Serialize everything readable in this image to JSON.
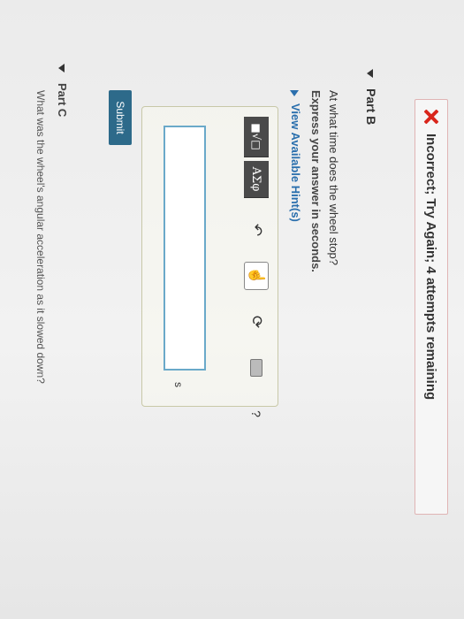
{
  "feedback": {
    "icon": "x-icon",
    "text": "Incorrect; Try Again; 4 attempts remaining",
    "color": "#d9261c"
  },
  "part_b": {
    "title": "Part B",
    "question": "At what time does the wheel stop?",
    "instruction": "Express your answer in seconds.",
    "hints_label": "View Available Hint(s)",
    "toolbar": {
      "templates_label": "■√□",
      "greek_label": "ΑΣφ",
      "undo_icon": "undo-icon",
      "pointer_icon": "hand-pointer-icon",
      "reset_icon": "refresh-icon",
      "keyboard_icon": "keyboard-icon",
      "help_label": "?"
    },
    "answer_value": "",
    "unit": "s",
    "submit_label": "Submit",
    "submit_color": "#2d6a8a"
  },
  "part_c": {
    "title": "Part C",
    "question": "What was the wheel's angular acceleration as it slowed down?"
  }
}
